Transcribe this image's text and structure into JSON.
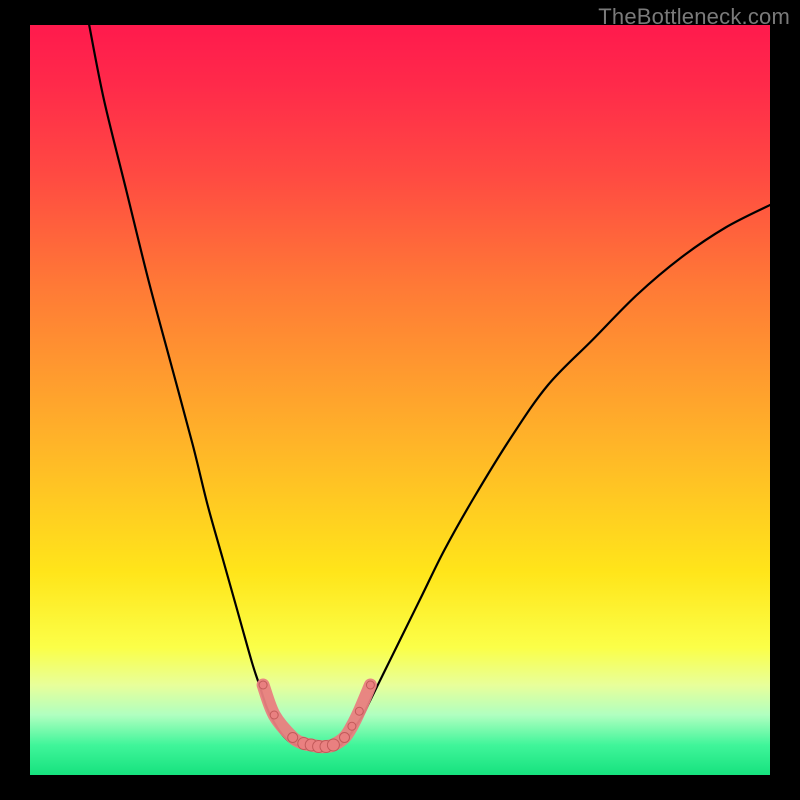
{
  "watermark": "TheBottleneck.com",
  "colors": {
    "background": "#000000",
    "curve": "#000000",
    "markers_fill": "#e98080",
    "markers_stroke": "#c25a5a",
    "gradient_top": "#ff1a4d",
    "gradient_bottom": "#16e27e"
  },
  "chart_data": {
    "type": "line",
    "title": "",
    "xlabel": "",
    "ylabel": "",
    "xlim": [
      0,
      100
    ],
    "ylim": [
      0,
      100
    ],
    "grid": false,
    "legend": false,
    "series": [
      {
        "name": "left-curve",
        "x": [
          8,
          10,
          13,
          16,
          19,
          22,
          24,
          26,
          28,
          30,
          31,
          32,
          33,
          34,
          35,
          36
        ],
        "values": [
          100,
          90,
          78,
          66,
          55,
          44,
          36,
          29,
          22,
          15,
          12,
          9,
          7,
          5.5,
          4.5,
          4
        ]
      },
      {
        "name": "right-curve",
        "x": [
          42,
          43,
          44,
          45,
          46,
          48,
          50,
          53,
          56,
          60,
          65,
          70,
          76,
          82,
          88,
          94,
          100
        ],
        "values": [
          4,
          5,
          6.5,
          8,
          10,
          14,
          18,
          24,
          30,
          37,
          45,
          52,
          58,
          64,
          69,
          73,
          76
        ]
      },
      {
        "name": "trough",
        "x": [
          36,
          38,
          40,
          42
        ],
        "values": [
          4,
          3.7,
          3.7,
          4
        ]
      }
    ],
    "markers": {
      "x": [
        31.5,
        33,
        35.5,
        37,
        38,
        39,
        40,
        41,
        42.5,
        43.5,
        44.5,
        46
      ],
      "values": [
        12,
        8,
        5,
        4.2,
        4,
        3.8,
        3.8,
        4,
        5,
        6.5,
        8.5,
        12
      ],
      "radius": [
        4,
        4,
        5,
        6,
        6,
        6,
        6,
        6,
        5,
        4,
        4,
        4
      ]
    }
  }
}
